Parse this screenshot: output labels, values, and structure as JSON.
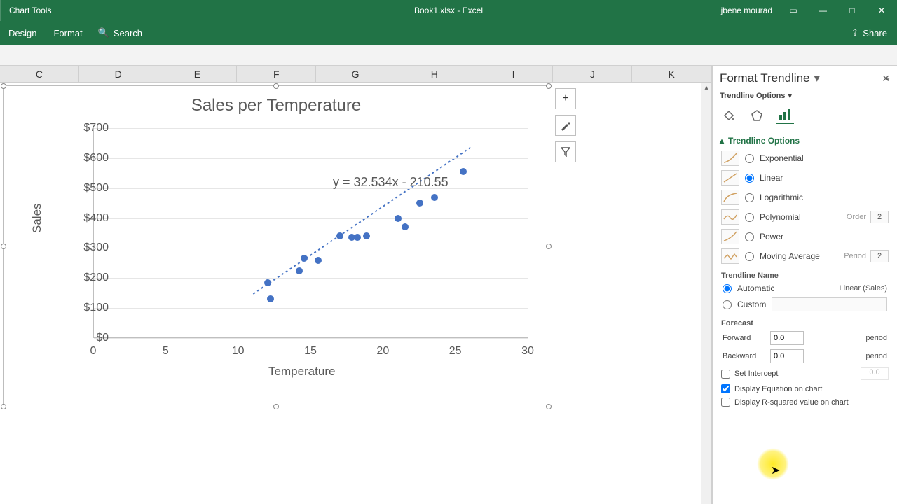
{
  "titlebar": {
    "chart_tools": "Chart Tools",
    "document": "Book1.xlsx  -  Excel",
    "user": "jbene mourad"
  },
  "ribbon": {
    "design": "Design",
    "format": "Format",
    "search": "Search",
    "share": "Share"
  },
  "columns": [
    "C",
    "D",
    "E",
    "F",
    "G",
    "H",
    "I",
    "J",
    "K"
  ],
  "chart_side": {
    "plus": "+"
  },
  "chart_data": {
    "type": "scatter",
    "title": "Sales per Temperature",
    "xlabel": "Temperature",
    "ylabel": "Sales",
    "xlim": [
      0,
      30
    ],
    "ylim": [
      0,
      700
    ],
    "x_ticks": [
      0,
      5,
      10,
      15,
      20,
      25,
      30
    ],
    "y_ticks": [
      "$0",
      "$100",
      "$200",
      "$300",
      "$400",
      "$500",
      "$600",
      "$700"
    ],
    "points": [
      {
        "x": 12.0,
        "y": 185
      },
      {
        "x": 12.2,
        "y": 130
      },
      {
        "x": 14.2,
        "y": 225
      },
      {
        "x": 14.5,
        "y": 265
      },
      {
        "x": 15.5,
        "y": 260
      },
      {
        "x": 17.0,
        "y": 340
      },
      {
        "x": 17.8,
        "y": 335
      },
      {
        "x": 18.2,
        "y": 335
      },
      {
        "x": 18.8,
        "y": 340
      },
      {
        "x": 21.0,
        "y": 400
      },
      {
        "x": 21.5,
        "y": 370
      },
      {
        "x": 22.5,
        "y": 450
      },
      {
        "x": 23.5,
        "y": 470
      },
      {
        "x": 25.5,
        "y": 555
      }
    ],
    "trendline": {
      "slope": 32.534,
      "intercept": -210.55,
      "dotted": true
    },
    "equation_label": "y = 32.534x - 210.55"
  },
  "pane": {
    "title": "Format Trendline",
    "sub": "Trendline Options",
    "section": "Trendline Options",
    "types": {
      "exponential": "Exponential",
      "linear": "Linear",
      "logarithmic": "Logarithmic",
      "polynomial": "Polynomial",
      "power": "Power",
      "moving": "Moving Average"
    },
    "order_label": "Order",
    "order_value": "2",
    "period_label": "Period",
    "period_value": "2",
    "trendline_name": "Trendline Name",
    "automatic": "Automatic",
    "automatic_value": "Linear (Sales)",
    "custom": "Custom",
    "forecast": "Forecast",
    "forward": "Forward",
    "forward_value": "0.0",
    "backward": "Backward",
    "backward_value": "0.0",
    "period_unit": "period",
    "set_intercept": "Set Intercept",
    "set_intercept_value": "0.0",
    "display_equation": "Display Equation on chart",
    "display_r2": "Display R-squared value on chart"
  }
}
